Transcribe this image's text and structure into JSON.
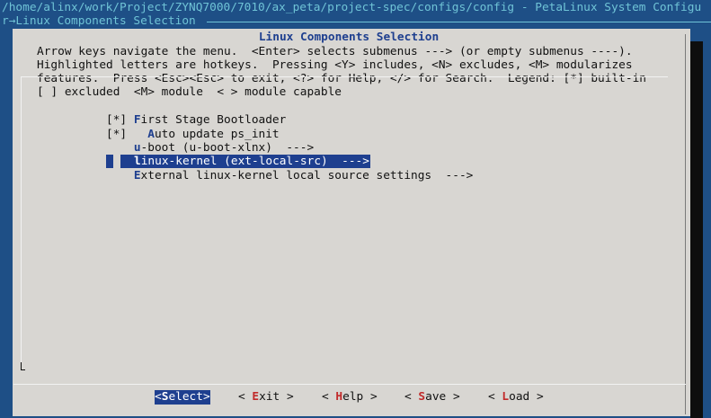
{
  "header": {
    "title": "/home/alinx/work/Project/ZYNQ7000/7010/ax_peta/project-spec/configs/config - PetaLinux System Configu",
    "breadcrumb": "r→Linux Components Selection"
  },
  "dialog": {
    "title": "Linux Components Selection",
    "help_lines": [
      "Arrow keys navigate the menu.  <Enter> selects submenus ---> (or empty submenus ----).",
      "Highlighted letters are hotkeys.  Pressing <Y> includes, <N> excludes, <M> modularizes",
      "features.  Press <Esc><Esc> to exit, <?> for Help, </> for Search.  Legend: [*] built-in",
      "[ ] excluded  <M> module  < > module capable"
    ]
  },
  "menu": {
    "items": [
      {
        "prefix": "[*] ",
        "hotkey": "F",
        "rest": "irst Stage Bootloader",
        "selected": false
      },
      {
        "prefix": "[*]   ",
        "hotkey": "A",
        "rest": "uto update ps_init",
        "selected": false
      },
      {
        "prefix": "    ",
        "hotkey": "u",
        "rest": "-boot (u-boot-xlnx)  --->",
        "selected": false
      },
      {
        "prefix": "    ",
        "hotkey": "l",
        "rest": "inux-kernel (ext-local-src)  --->",
        "selected": true
      },
      {
        "prefix": "    ",
        "hotkey": "E",
        "rest": "xternal linux-kernel local source settings  --->",
        "selected": false
      }
    ]
  },
  "buttons": [
    {
      "pre": "<",
      "hotkey": "S",
      "rest": "elect>",
      "selected": true
    },
    {
      "pre": "< ",
      "hotkey": "E",
      "rest": "xit >",
      "selected": false
    },
    {
      "pre": "< ",
      "hotkey": "H",
      "rest": "elp >",
      "selected": false
    },
    {
      "pre": "< ",
      "hotkey": "S",
      "rest": "ave >",
      "selected": false
    },
    {
      "pre": "< ",
      "hotkey": "L",
      "rest": "oad >",
      "selected": false
    }
  ],
  "colors": {
    "background": "#1e4f86",
    "dialog": "#d8d6d2",
    "selection": "#1e3f8f",
    "hotkey_button": "#c12a2a"
  }
}
